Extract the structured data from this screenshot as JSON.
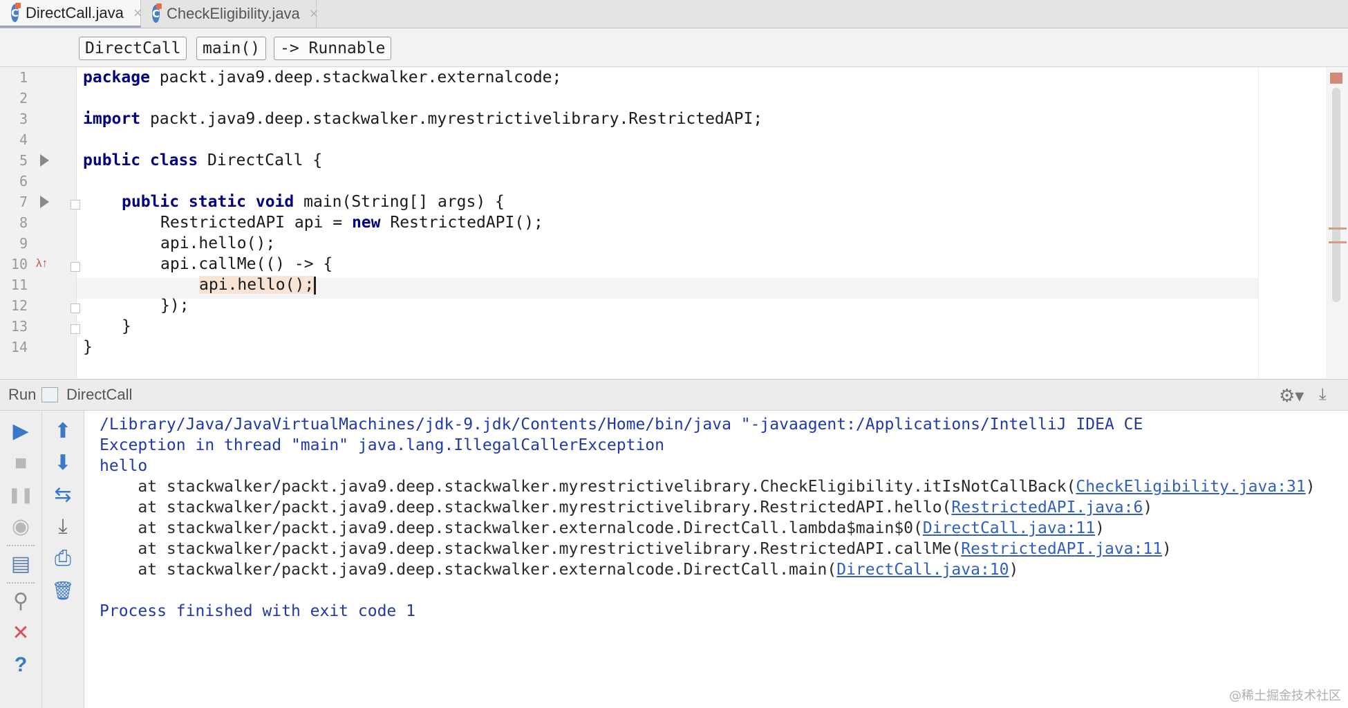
{
  "tabs": [
    {
      "label": "DirectCall.java",
      "active": true
    },
    {
      "label": "CheckEligibility.java",
      "active": false
    }
  ],
  "tab_close": "×",
  "class_icon": "C",
  "breadcrumbs": [
    "DirectCall",
    "main()",
    "-> Runnable"
  ],
  "editor": {
    "line_numbers": [
      "1",
      "2",
      "3",
      "4",
      "5",
      "6",
      "7",
      "8",
      "9",
      "10",
      "11",
      "12",
      "13",
      "14"
    ],
    "lines": [
      {
        "kw": "package",
        "text": " packt.java9.deep.stackwalker.externalcode;"
      },
      {
        "kw": "import",
        "text": " packt.java9.deep.stackwalker.myrestrictivelibrary.RestrictedAPI;"
      },
      {
        "kw": "public class",
        "text": " DirectCall {"
      },
      {
        "kw": "public static void",
        "text": " main(String[] args) {"
      },
      {
        "text": "RestrictedAPI api = "
      },
      {
        "kw": "new",
        "text": " RestrictedAPI();"
      },
      {
        "text": "api.hello();"
      },
      {
        "text": "api.callMe(() -> {"
      },
      {
        "text": "api.hello();"
      },
      {
        "text": "});"
      },
      {
        "text": "}"
      },
      {
        "text": "}"
      }
    ]
  },
  "run_panel": {
    "title": "Run",
    "config": "DirectCall",
    "gear_icon": "⚙▾",
    "pin_icon": "⤓"
  },
  "console": {
    "cmd": "/Library/Java/JavaVirtualMachines/jdk-9.jdk/Contents/Home/bin/java \"-javaagent:/Applications/IntelliJ IDEA CE",
    "exception": "Exception in thread \"main\" java.lang.IllegalCallerException",
    "hello": "hello",
    "frames": [
      {
        "prefix": "    at stackwalker/packt.java9.deep.stackwalker.myrestrictivelibrary.CheckEligibility.itIsNotCallBack(",
        "link": "CheckEligibility.java:31",
        "suffix": ")"
      },
      {
        "prefix": "    at stackwalker/packt.java9.deep.stackwalker.myrestrictivelibrary.RestrictedAPI.hello(",
        "link": "RestrictedAPI.java:6",
        "suffix": ")"
      },
      {
        "prefix": "    at stackwalker/packt.java9.deep.stackwalker.externalcode.DirectCall.lambda$main$0(",
        "link": "DirectCall.java:11",
        "suffix": ")"
      },
      {
        "prefix": "    at stackwalker/packt.java9.deep.stackwalker.myrestrictivelibrary.RestrictedAPI.callMe(",
        "link": "RestrictedAPI.java:11",
        "suffix": ")"
      },
      {
        "prefix": "    at stackwalker/packt.java9.deep.stackwalker.externalcode.DirectCall.main(",
        "link": "DirectCall.java:10",
        "suffix": ")"
      }
    ],
    "finished": "Process finished with exit code 1"
  },
  "toolbar_icons": {
    "rerun": "▶",
    "stop": "■",
    "pause": "❚❚",
    "dump": "◉",
    "layout": "▤",
    "pin": "⚲",
    "close": "✕",
    "help": "?",
    "up": "⬆",
    "down": "⬇",
    "wrap": "⇆",
    "scroll_end": "⤓",
    "print": "⎙",
    "clear": "🗑"
  },
  "colors": {
    "keyword": "#000080",
    "link": "#2f5fc0",
    "console_text": "#1f3aa8",
    "rerun": "#3a78c9",
    "close": "#d9534f"
  },
  "watermark": "@稀土掘金技术社区"
}
